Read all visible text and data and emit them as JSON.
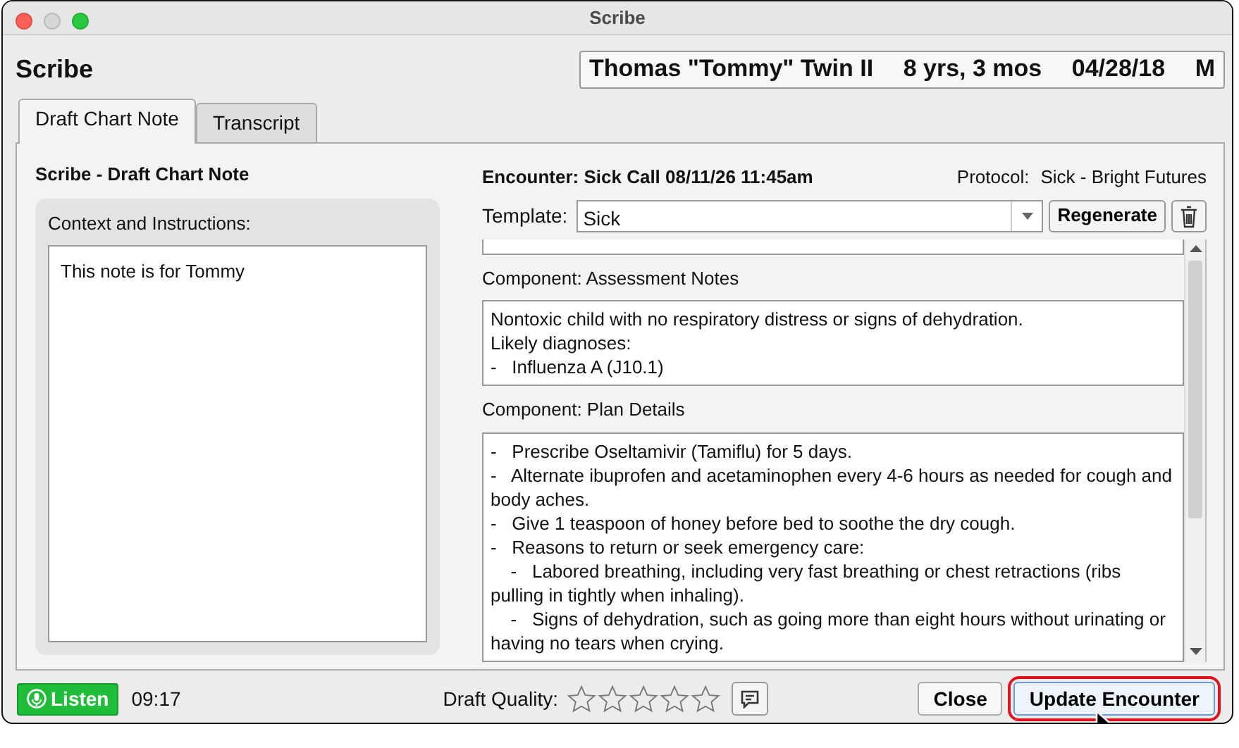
{
  "window": {
    "title": "Scribe"
  },
  "app_title": "Scribe",
  "patient": {
    "name": "Thomas \"Tommy\" Twin II",
    "age": "8 yrs, 3 mos",
    "dob": "04/28/18",
    "sex": "M"
  },
  "tabs": [
    {
      "label": "Draft Chart Note",
      "selected": true
    },
    {
      "label": "Transcript",
      "selected": false
    }
  ],
  "draft_panel": {
    "title": "Scribe - Draft Chart Note",
    "context": {
      "label": "Context and Instructions:",
      "value": "This note is for Tommy"
    }
  },
  "encounter": {
    "title": "Encounter: Sick Call 08/11/26 11:45am",
    "protocol_label": "Protocol:",
    "protocol": "Sick - Bright Futures"
  },
  "template": {
    "label": "Template:",
    "value": "Sick",
    "regenerate": "Regenerate"
  },
  "components": [
    {
      "title": "Component: Assessment Notes",
      "lines": [
        {
          "text": "Nontoxic child with no respiratory distress or signs of dehydration."
        },
        {
          "text": "Likely diagnoses:"
        },
        {
          "text": "-   Influenza A (J10.1)"
        }
      ]
    },
    {
      "title": "Component: Plan Details",
      "lines": [
        {
          "text": "-   Prescribe Oseltamivir (Tamiflu) for 5 days."
        },
        {
          "text": "-   Alternate ibuprofen and acetaminophen every 4-6 hours as needed for cough and body aches."
        },
        {
          "text": "-   Give 1 teaspoon of honey before bed to soothe the dry cough."
        },
        {
          "text": "-   Reasons to return or seek emergency care:",
          "children": [
            {
              "text": "-   Labored breathing, including very fast breathing or chest retractions (ribs pulling in tightly when inhaling)."
            },
            {
              "text": "-   Signs of dehydration, such as going more than eight hours without urinating or having no tears when crying."
            }
          ]
        }
      ]
    }
  ],
  "footer": {
    "listen": "Listen",
    "timer": "09:17",
    "quality_label": "Draft Quality:",
    "stars": 0,
    "close": "Close",
    "update": "Update Encounter",
    "update_highlighted": true
  }
}
